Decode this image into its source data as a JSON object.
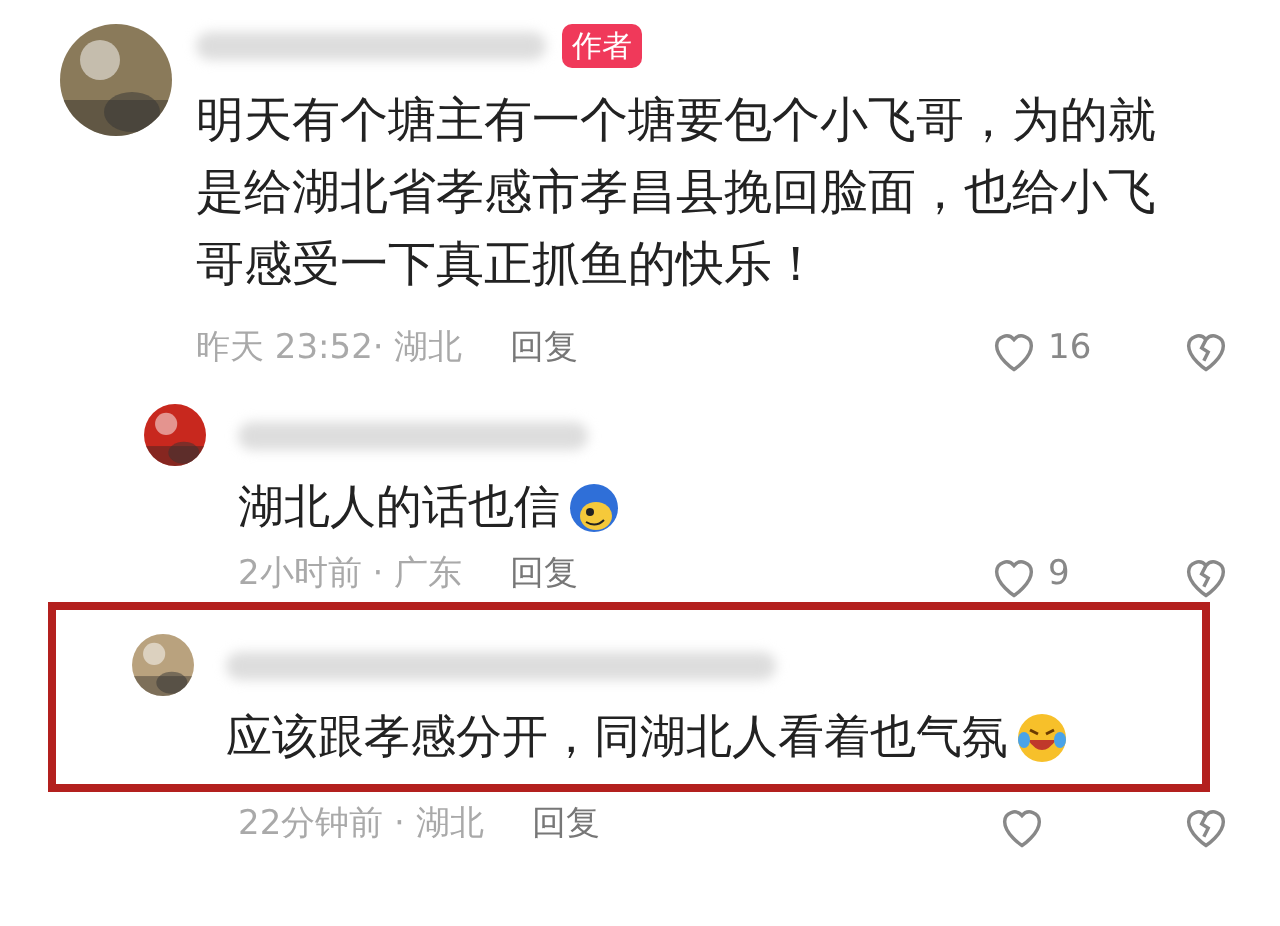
{
  "comments": [
    {
      "badge": "作者",
      "text": "明天有个塘主有一个塘要包个小飞哥，为的就是给湖北省孝感市孝昌县挽回脸面，也给小飞哥感受一下真正抓鱼的快乐！",
      "meta": "昨天 23:52· 湖北",
      "reply_label": "回复",
      "likes": "16",
      "children": [
        {
          "kind": "blue-hair",
          "text": "湖北人的话也信",
          "meta": "2小时前 · 广东",
          "reply_label": "回复",
          "likes": "9",
          "highlighted": false
        },
        {
          "kind": "tears-of-joy",
          "text": "应该跟孝感分开，同湖北人看着也气氛",
          "meta": "22分钟前 · 湖北",
          "reply_label": "回复",
          "highlighted": true
        }
      ]
    }
  ]
}
